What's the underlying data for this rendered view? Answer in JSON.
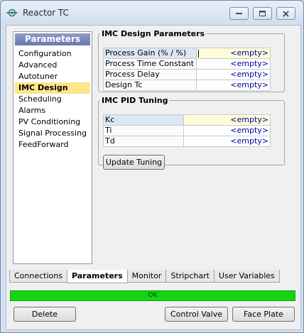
{
  "window": {
    "title": "Reactor TC"
  },
  "left_panel": {
    "header": "Parameters",
    "items": [
      "Configuration",
      "Advanced",
      "Autotuner",
      "IMC Design",
      "Scheduling",
      "Alarms",
      "PV Conditioning",
      "Signal Processing",
      "FeedForward"
    ],
    "selected": "IMC Design"
  },
  "imc_design": {
    "title": "IMC Design Parameters",
    "rows": [
      {
        "label": "Process Gain (% / %)",
        "value": "<empty>"
      },
      {
        "label": "Process Time Constant",
        "value": "<empty>"
      },
      {
        "label": "Process Delay",
        "value": "<empty>"
      },
      {
        "label": "Design Tc",
        "value": "<empty>"
      }
    ]
  },
  "imc_pid": {
    "title": "IMC PID Tuning",
    "rows": [
      {
        "label": "Kc",
        "value": "<empty>"
      },
      {
        "label": "Ti",
        "value": "<empty>"
      },
      {
        "label": "Td",
        "value": "<empty>"
      }
    ],
    "update_label": "Update Tuning"
  },
  "tabs": [
    "Connections",
    "Parameters",
    "Monitor",
    "Stripchart",
    "User Variables"
  ],
  "active_tab": "Parameters",
  "status": "OK",
  "buttons": {
    "delete": "Delete",
    "control_valve": "Control Valve",
    "face_plate": "Face Plate"
  },
  "colors": {
    "status_ok": "#12d512",
    "selection": "#fde58a",
    "header": "#7b86b8"
  }
}
